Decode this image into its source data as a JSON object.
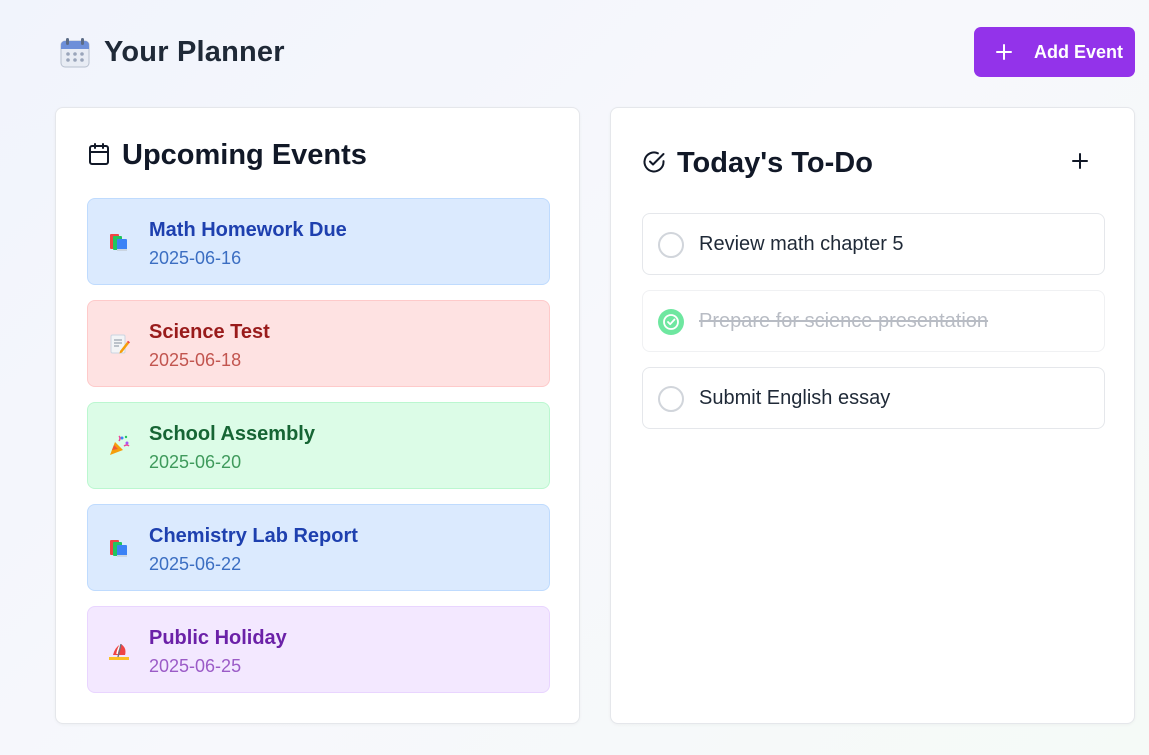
{
  "header": {
    "app_icon": "calendar-emoji-icon",
    "title": "Your Planner",
    "add_event_label": "Add Event",
    "accent_color": "#9333ea"
  },
  "events_panel": {
    "title": "Upcoming Events",
    "icon": "calendar-outline-icon",
    "events": [
      {
        "title": "Math Homework Due",
        "date": "2025-06-16",
        "emoji": "books-icon",
        "theme": "blue"
      },
      {
        "title": "Science Test",
        "date": "2025-06-18",
        "emoji": "memo-icon",
        "theme": "red"
      },
      {
        "title": "School Assembly",
        "date": "2025-06-20",
        "emoji": "party-popper-icon",
        "theme": "green"
      },
      {
        "title": "Chemistry Lab Report",
        "date": "2025-06-22",
        "emoji": "books-icon",
        "theme": "blue"
      },
      {
        "title": "Public Holiday",
        "date": "2025-06-25",
        "emoji": "beach-umbrella-icon",
        "theme": "purple"
      }
    ]
  },
  "todo_panel": {
    "title": "Today's To-Do",
    "icon": "check-circle-icon",
    "add_icon": "plus-icon",
    "items": [
      {
        "text": "Review math chapter 5",
        "done": false
      },
      {
        "text": "Prepare for science presentation",
        "done": true
      },
      {
        "text": "Submit English essay",
        "done": false
      }
    ]
  },
  "themes": {
    "blue": {
      "bg": "#dbeafe",
      "border": "#bfdbfe",
      "title": "#1e40af",
      "date": "#3b6ec2"
    },
    "red": {
      "bg": "#fee2e2",
      "border": "#fecaca",
      "title": "#991b1b",
      "date": "#c2554f"
    },
    "green": {
      "bg": "#dcfce7",
      "border": "#bbf7d0",
      "title": "#166534",
      "date": "#3f9a5c"
    },
    "purple": {
      "bg": "#f3e8ff",
      "border": "#e9d5ff",
      "title": "#6b21a8",
      "date": "#9b5bc7"
    }
  }
}
